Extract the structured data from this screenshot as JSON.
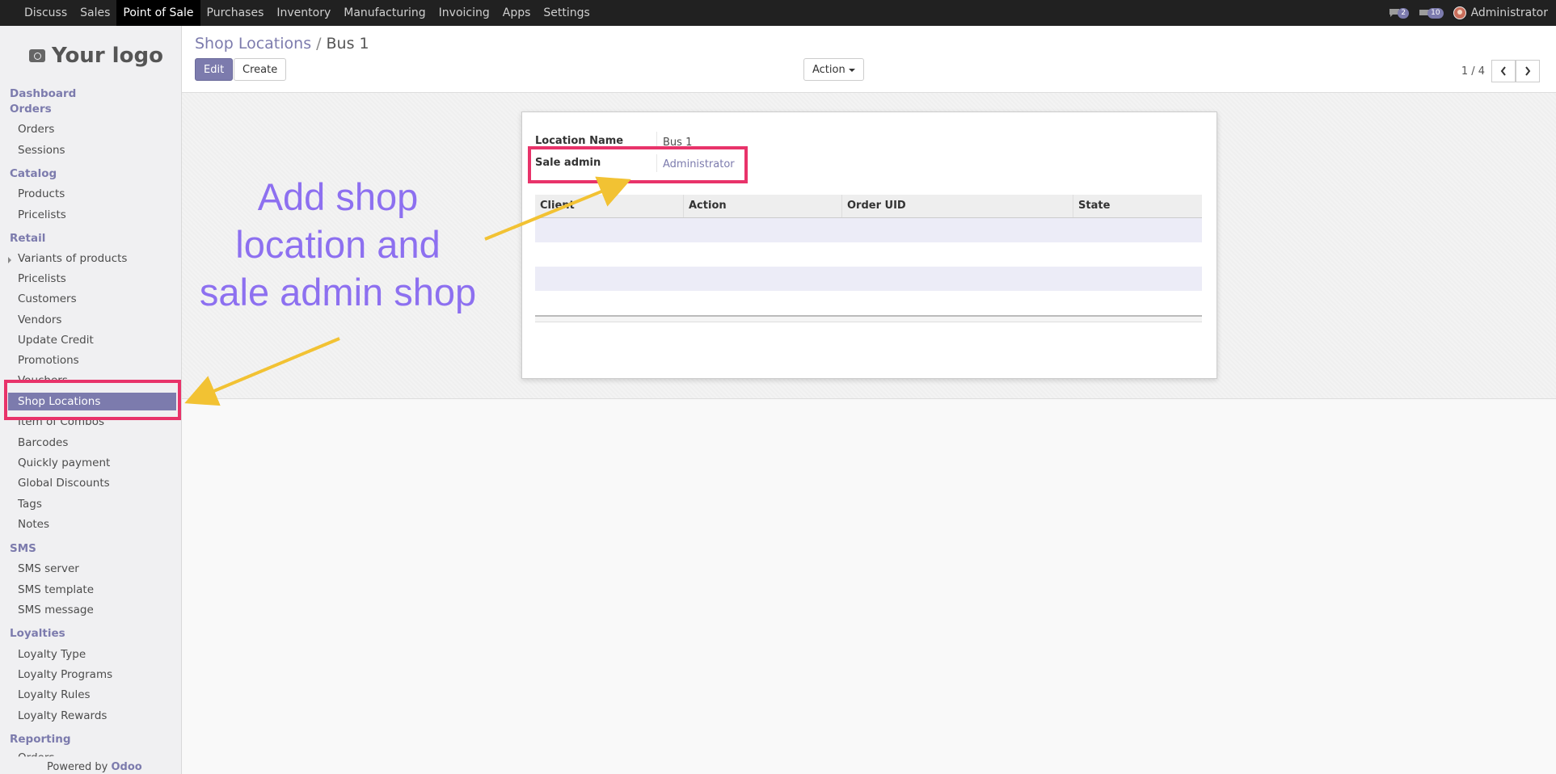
{
  "topbar": {
    "menu": [
      "Discuss",
      "Sales",
      "Point of Sale",
      "Purchases",
      "Inventory",
      "Manufacturing",
      "Invoicing",
      "Apps",
      "Settings"
    ],
    "active": "Point of Sale",
    "chat_count": "2",
    "message_count": "10",
    "user": "Administrator"
  },
  "sidebar": {
    "logo_text": "Your logo",
    "sections": {
      "dashboard": "Dashboard",
      "orders": "Orders",
      "catalog": "Catalog",
      "retail": "Retail",
      "sms": "SMS",
      "loyalties": "Loyalties",
      "reporting": "Reporting"
    },
    "items": {
      "orders": "Orders",
      "sessions": "Sessions",
      "products": "Products",
      "pricelists_catalog": "Pricelists",
      "variants": "Variants of products",
      "pricelists_retail": "Pricelists",
      "customers": "Customers",
      "vendors": "Vendors",
      "update_credit": "Update Credit",
      "promotions": "Promotions",
      "vouchers": "Vouchers",
      "shop_locations": "Shop Locations",
      "item_combos": "Item of Combos",
      "barcodes": "Barcodes",
      "quickly_payment": "Quickly payment",
      "global_discounts": "Global Discounts",
      "tags": "Tags",
      "notes": "Notes",
      "sms_server": "SMS server",
      "sms_template": "SMS template",
      "sms_message": "SMS message",
      "loyalty_type": "Loyalty Type",
      "loyalty_programs": "Loyalty Programs",
      "loyalty_rules": "Loyalty Rules",
      "loyalty_rewards": "Loyalty Rewards",
      "reporting_orders": "Orders"
    },
    "powered_prefix": "Powered by",
    "powered_brand": "Odoo"
  },
  "control": {
    "breadcrumb_parent": "Shop Locations",
    "breadcrumb_sep": "/",
    "breadcrumb_current": "Bus 1",
    "edit_label": "Edit",
    "create_label": "Create",
    "action_label": "Action",
    "pager_text": "1 / 4"
  },
  "form": {
    "location_name_label": "Location Name",
    "location_name_value": "Bus 1",
    "sale_admin_label": "Sale admin",
    "sale_admin_value": "Administrator",
    "table_columns": [
      "Client",
      "Action",
      "Order UID",
      "State"
    ]
  },
  "annotation": {
    "text_line1": "Add shop",
    "text_line2": "location and",
    "text_line3": "sale admin shop",
    "highlight_color": "#e8336a",
    "arrow_color": "#f2c233",
    "text_color": "#8d70f0"
  },
  "colors": {
    "accent": "#7c7bad",
    "topbar": "#212121"
  }
}
